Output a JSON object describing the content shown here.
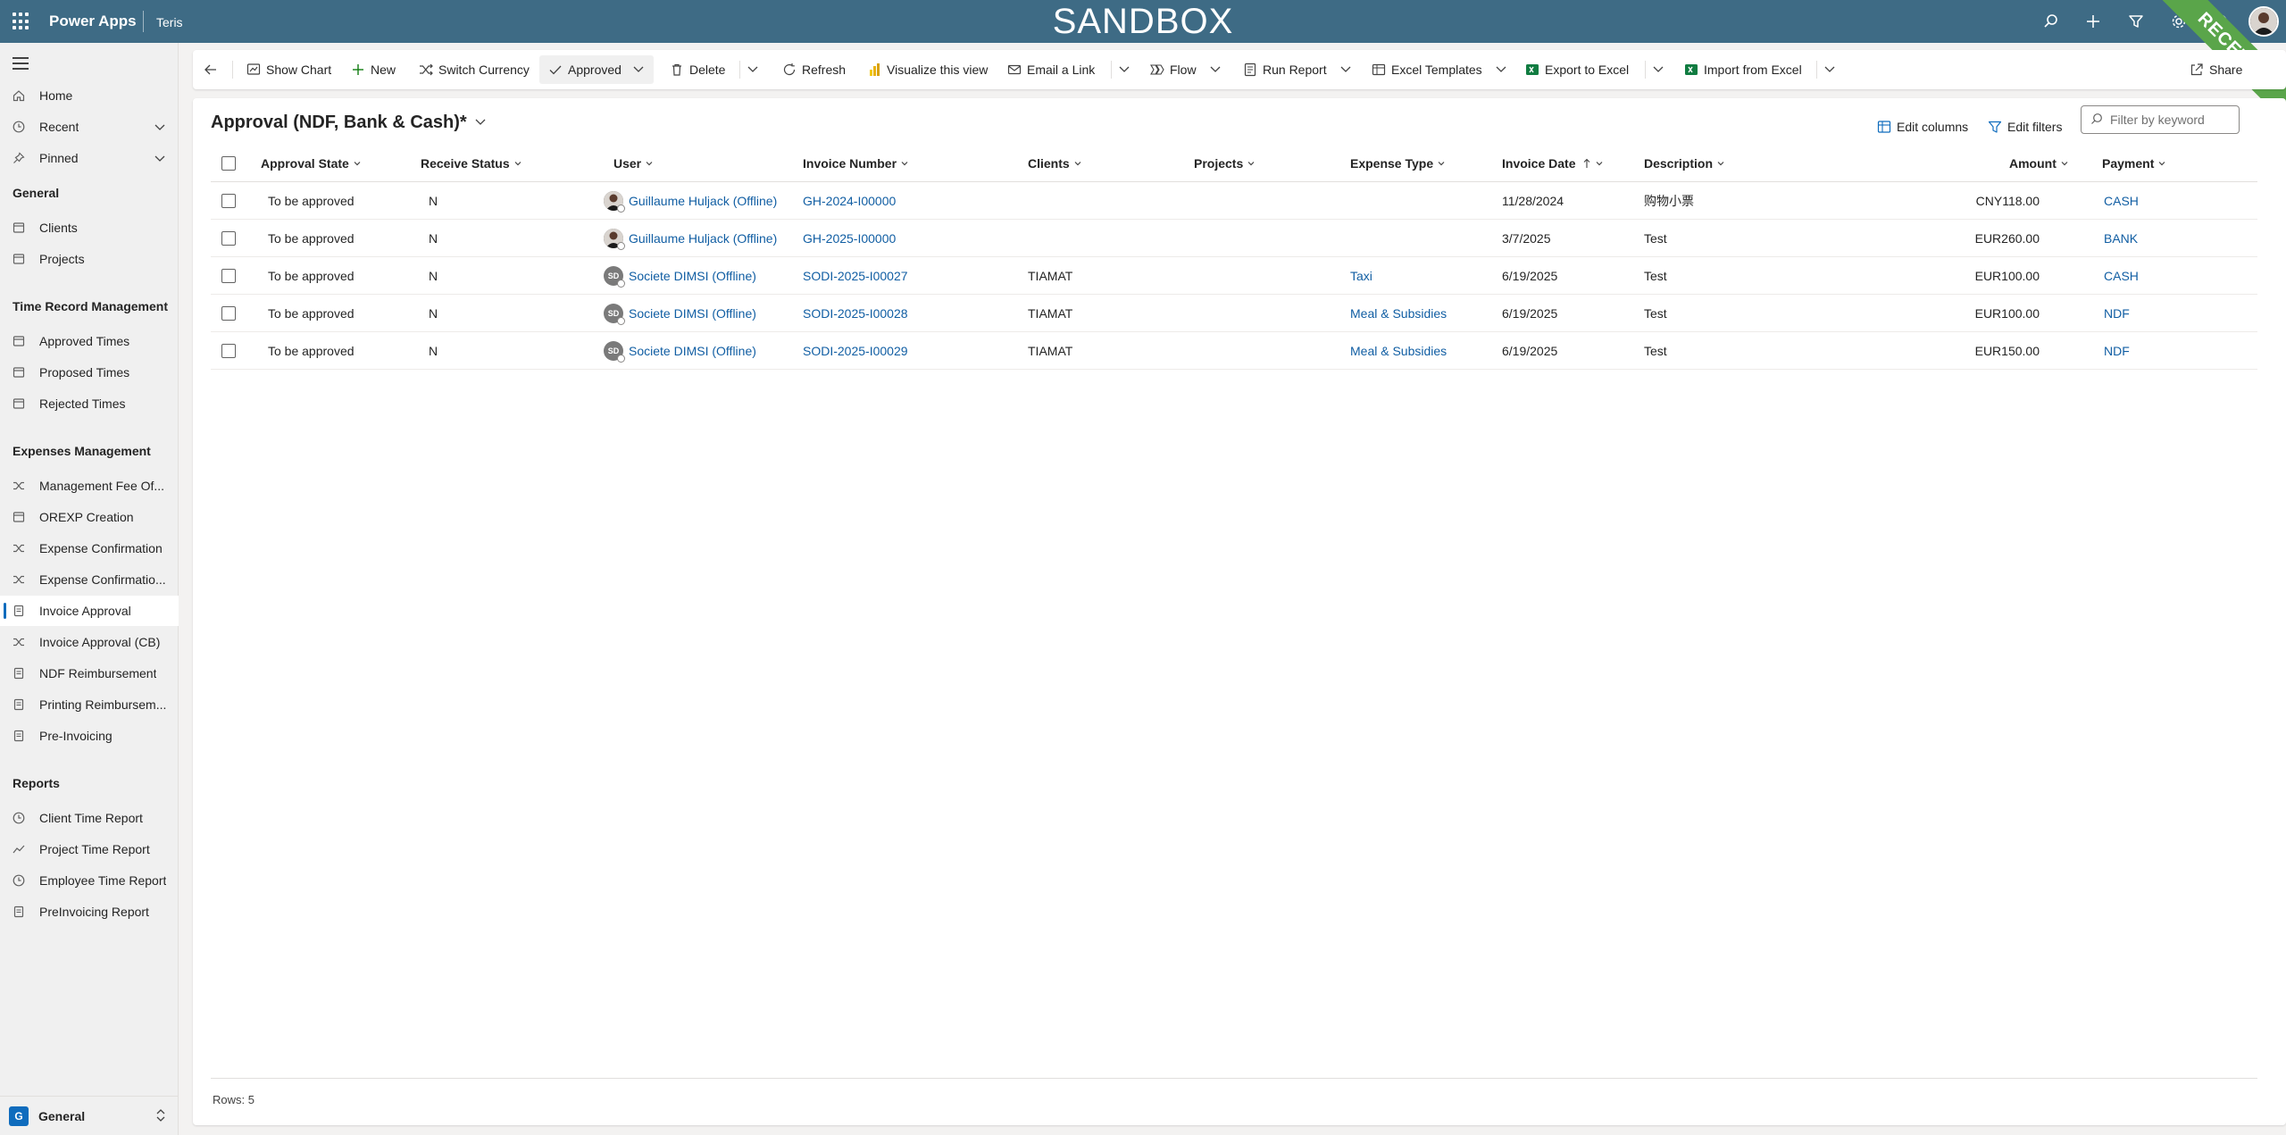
{
  "topbar": {
    "app_name": "Power Apps",
    "environment": "Teris",
    "banner": "SANDBOX",
    "ribbon": "RECETTE"
  },
  "nav": {
    "home": "Home",
    "recent": "Recent",
    "pinned": "Pinned",
    "sections": [
      {
        "title": "General",
        "items": [
          "Clients",
          "Projects"
        ]
      },
      {
        "title": "Time Record Management",
        "items": [
          "Approved Times",
          "Proposed Times",
          "Rejected Times"
        ]
      },
      {
        "title": "Expenses Management",
        "items": [
          "Management Fee Of...",
          "OREXP Creation",
          "Expense Confirmation",
          "Expense Confirmatio...",
          "Invoice Approval",
          "Invoice Approval (CB)",
          "NDF Reimbursement",
          "Printing Reimbursem...",
          "Pre-Invoicing"
        ]
      },
      {
        "title": "Reports",
        "items": [
          "Client Time Report",
          "Project Time Report",
          "Employee Time Report",
          "PreInvoicing Report"
        ]
      }
    ],
    "active_item": "Invoice Approval",
    "area_badge": "G",
    "area_label": "General"
  },
  "commands": {
    "show_chart": "Show Chart",
    "new": "New",
    "switch_currency": "Switch Currency",
    "approved": "Approved",
    "delete": "Delete",
    "refresh": "Refresh",
    "visualize": "Visualize this view",
    "email_link": "Email a Link",
    "flow": "Flow",
    "run_report": "Run Report",
    "excel_templates": "Excel Templates",
    "export_excel": "Export to Excel",
    "import_excel": "Import from Excel",
    "share": "Share"
  },
  "view": {
    "title": "Approval (NDF, Bank & Cash)*",
    "edit_columns": "Edit columns",
    "edit_filters": "Edit filters",
    "filter_placeholder": "Filter by keyword"
  },
  "columns": {
    "approval_state": "Approval State",
    "receive_status": "Receive Status",
    "user": "User",
    "invoice_number": "Invoice Number",
    "clients": "Clients",
    "projects": "Projects",
    "expense_type": "Expense Type",
    "invoice_date": "Invoice Date",
    "description": "Description",
    "amount": "Amount",
    "payment": "Payment"
  },
  "rows": [
    {
      "approval_state": "To be approved",
      "receive_status": "N",
      "user": "Guillaume Huljack (Offline)",
      "avatar": "photo",
      "initials": "",
      "invoice_number": "GH-2024-I00000",
      "clients": "",
      "projects": "",
      "expense_type": "",
      "invoice_date": "11/28/2024",
      "description": "购物小票",
      "amount": "CNY118.00",
      "payment": "CASH"
    },
    {
      "approval_state": "To be approved",
      "receive_status": "N",
      "user": "Guillaume Huljack (Offline)",
      "avatar": "photo",
      "initials": "",
      "invoice_number": "GH-2025-I00000",
      "clients": "",
      "projects": "",
      "expense_type": "",
      "invoice_date": "3/7/2025",
      "description": "Test",
      "amount": "EUR260.00",
      "payment": "BANK"
    },
    {
      "approval_state": "To be approved",
      "receive_status": "N",
      "user": "Societe DIMSI (Offline)",
      "avatar": "initials",
      "initials": "SD",
      "invoice_number": "SODI-2025-I00027",
      "clients": "TIAMAT",
      "projects": "",
      "expense_type": "Taxi",
      "invoice_date": "6/19/2025",
      "description": "Test",
      "amount": "EUR100.00",
      "payment": "CASH"
    },
    {
      "approval_state": "To be approved",
      "receive_status": "N",
      "user": "Societe DIMSI (Offline)",
      "avatar": "initials",
      "initials": "SD",
      "invoice_number": "SODI-2025-I00028",
      "clients": "TIAMAT",
      "projects": "",
      "expense_type": "Meal & Subsidies",
      "invoice_date": "6/19/2025",
      "description": "Test",
      "amount": "EUR100.00",
      "payment": "NDF"
    },
    {
      "approval_state": "To be approved",
      "receive_status": "N",
      "user": "Societe DIMSI (Offline)",
      "avatar": "initials",
      "initials": "SD",
      "invoice_number": "SODI-2025-I00029",
      "clients": "TIAMAT",
      "projects": "",
      "expense_type": "Meal & Subsidies",
      "invoice_date": "6/19/2025",
      "description": "Test",
      "amount": "EUR150.00",
      "payment": "NDF"
    }
  ],
  "footer": {
    "rows_count": "Rows: 5"
  },
  "colors": {
    "topbar": "#3e6b85",
    "link": "#115ea3",
    "ribbon": "#5aa54a",
    "accent": "#0f6cbd"
  }
}
